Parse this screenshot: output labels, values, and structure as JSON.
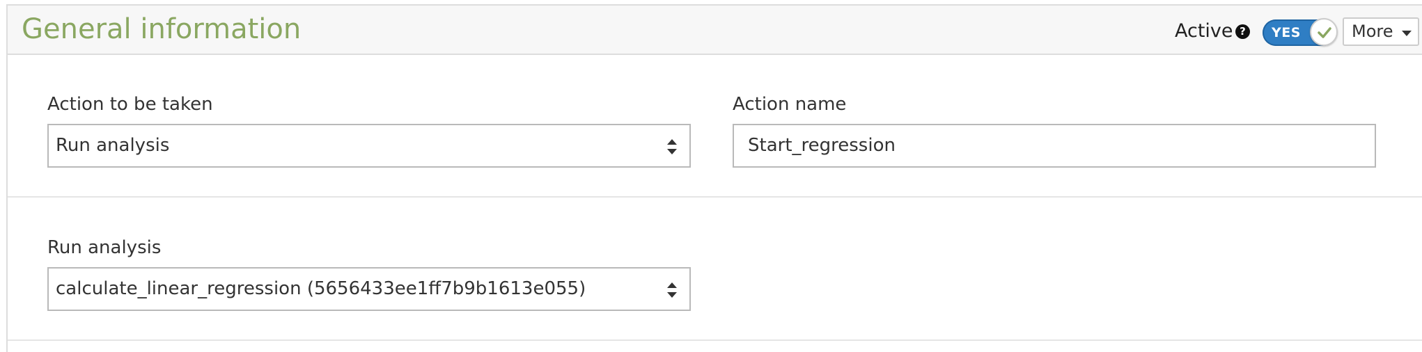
{
  "panel": {
    "title": "General information",
    "active": {
      "label": "Active",
      "help_icon": "question-circle-icon",
      "toggle_text": "YES",
      "toggle_on": true,
      "toggle_check_icon": "check-icon",
      "toggle_color": "#2f7ec4",
      "check_color": "#8aa761"
    },
    "more_button": {
      "label": "More",
      "icon": "caret-down-icon"
    },
    "title_color": "#8aa761"
  },
  "fields": {
    "action_to_be_taken": {
      "label": "Action to be taken",
      "value": "Run analysis",
      "icon": "sort-arrows-icon"
    },
    "action_name": {
      "label": "Action name",
      "value": "Start_regression"
    },
    "run_analysis": {
      "label": "Run analysis",
      "value": "calculate_linear_regression (5656433ee1ff7b9b1613e055)",
      "icon": "sort-arrows-icon"
    }
  }
}
